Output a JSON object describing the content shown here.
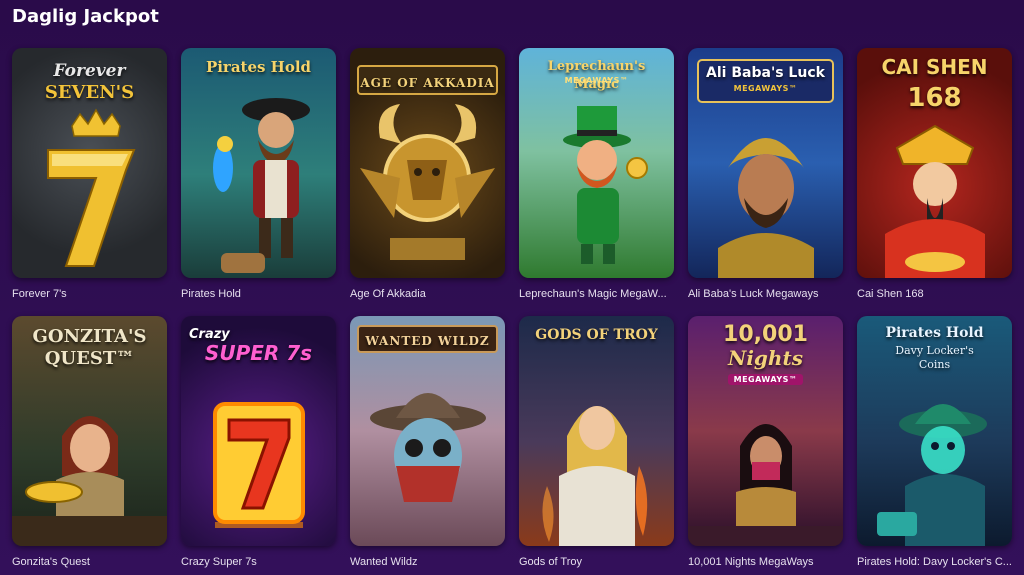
{
  "section": {
    "title": "Daglig Jackpot"
  },
  "games": [
    {
      "label": "Forever 7's",
      "art_title": "Forever",
      "art_title2": "SEVEN'S",
      "art_sub": ""
    },
    {
      "label": "Pirates Hold",
      "art_title": "Pirates Hold",
      "art_title2": "",
      "art_sub": ""
    },
    {
      "label": "Age Of Akkadia",
      "art_title": "AGE OF AKKADIA",
      "art_title2": "",
      "art_sub": ""
    },
    {
      "label": "Leprechaun's Magic MegaW...",
      "art_title": "Leprechaun's Magic",
      "art_title2": "",
      "art_sub": "MEGAWAYS™"
    },
    {
      "label": "Ali Baba's Luck Megaways",
      "art_title": "Ali Baba's Luck",
      "art_title2": "",
      "art_sub": "MEGAWAYS™"
    },
    {
      "label": "Cai Shen 168",
      "art_title": "CAI SHEN",
      "art_title2": "168",
      "art_sub": ""
    },
    {
      "label": "Gonzita's Quest",
      "art_title": "GONZITA'S",
      "art_title2": "QUEST™",
      "art_sub": ""
    },
    {
      "label": "Crazy Super 7s",
      "art_title": "Crazy",
      "art_title2": "SUPER 7s",
      "art_sub": ""
    },
    {
      "label": "Wanted Wildz",
      "art_title": "WANTED WILDZ",
      "art_title2": "",
      "art_sub": ""
    },
    {
      "label": "Gods of Troy",
      "art_title": "GODS OF TROY",
      "art_title2": "",
      "art_sub": ""
    },
    {
      "label": "10,001 Nights MegaWays",
      "art_title": "10,001",
      "art_title2": "Nights",
      "art_sub": "MEGAWAYS™"
    },
    {
      "label": "Pirates Hold: Davy Locker's C...",
      "art_title": "Pirates Hold",
      "art_title2": "Davy Locker's",
      "art_sub": "Coins"
    }
  ],
  "colors": {
    "background": "#2a0b4a",
    "label_text": "#e6e0ee",
    "gold": "#f3c43a"
  }
}
